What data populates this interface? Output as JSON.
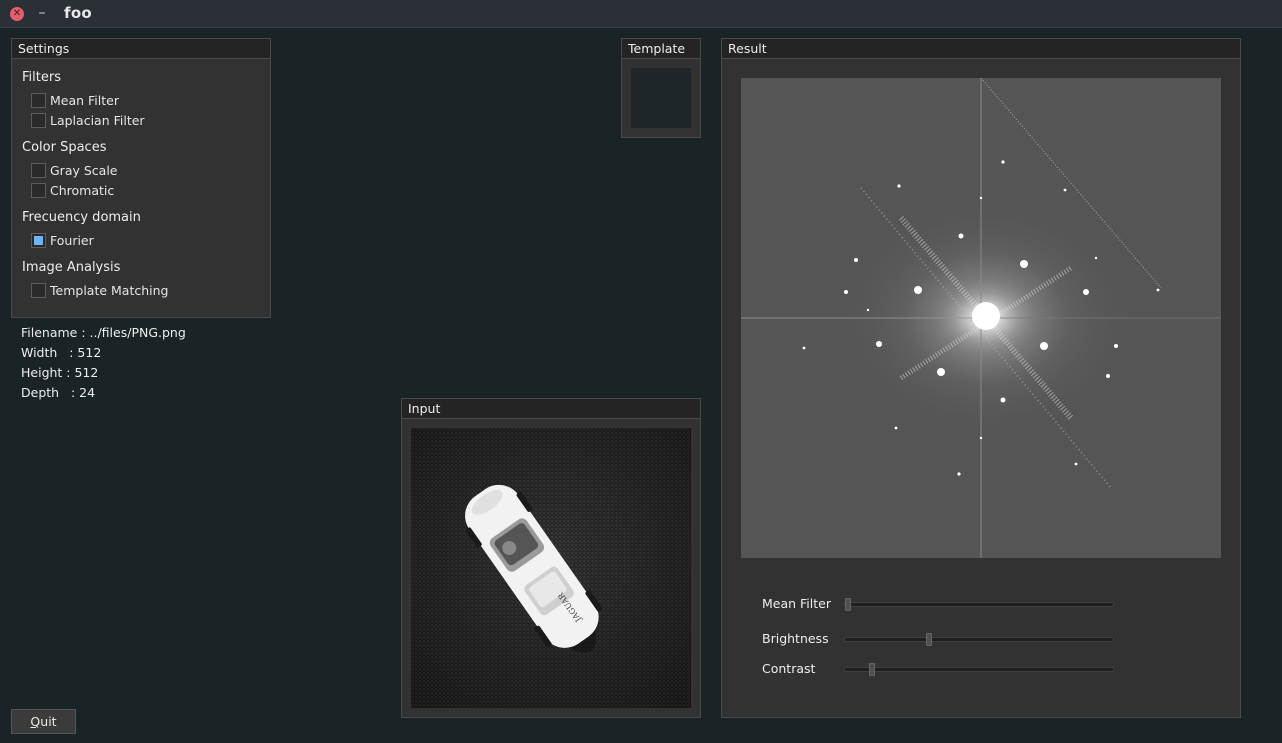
{
  "window": {
    "title": "foo",
    "close_glyph": "✕",
    "minimize_glyph": "–"
  },
  "settings": {
    "header": "Settings",
    "groups": [
      {
        "title": "Filters",
        "items": [
          {
            "label": "Mean Filter",
            "checked": false
          },
          {
            "label": "Laplacian Filter",
            "checked": false
          }
        ]
      },
      {
        "title": "Color Spaces",
        "items": [
          {
            "label": "Gray Scale",
            "checked": false
          },
          {
            "label": "Chromatic",
            "checked": false
          }
        ]
      },
      {
        "title": "Frecuency domain",
        "items": [
          {
            "label": "Fourier",
            "checked": true
          }
        ]
      },
      {
        "title": "Image Analysis",
        "items": [
          {
            "label": "Template Matching",
            "checked": false
          }
        ]
      }
    ]
  },
  "file_info": {
    "filename": "Filename : ../files/PNG.png",
    "width": "Width   : 512",
    "height": "Height : 512",
    "depth": "Depth   : 24"
  },
  "template_panel": {
    "header": "Template"
  },
  "input_panel": {
    "header": "Input",
    "car_text": "JAGUAR"
  },
  "result_panel": {
    "header": "Result",
    "sliders": [
      {
        "label": "Mean Filter",
        "value": 0.0
      },
      {
        "label": "Brightness",
        "value": 0.31
      },
      {
        "label": "Contrast",
        "value": 0.09
      }
    ]
  },
  "quit_button": {
    "label": "Quit",
    "mnemonic": "Q",
    "rest": "uit"
  },
  "colors": {
    "accent": "#6fb4f3",
    "close": "#e35d6a",
    "background": "#1a2326"
  }
}
